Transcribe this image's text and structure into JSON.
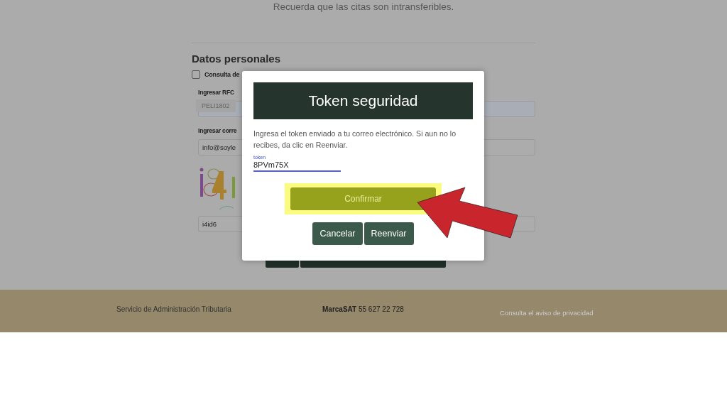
{
  "page": {
    "notice": "Recuerda que las citas son intransferibles.",
    "section_title": "Datos personales",
    "checkbox": {
      "label": "Consulta de",
      "checked": false
    },
    "rfc": {
      "label": "Ingresar RFC",
      "autofill": "PELI1802"
    },
    "email": {
      "label": "Ingresar corre",
      "value": "info@soyle"
    },
    "captcha": {
      "value": "i4id6"
    },
    "buttons": [
      {
        "kind": "exit"
      },
      {
        "kind": "next"
      }
    ]
  },
  "footer": {
    "org": "Servicio de Administración Tributaria",
    "phone": "**MarcaSAT** 55 627 22 728",
    "privacy_link": "Consulta el aviso de privacidad"
  },
  "dialog": {
    "title": "Token seguridad",
    "message": "Ingresa el token enviado a tu correo electrónico. Si aun no lo recibes, da clic en Reenviar.",
    "token": {
      "label": "token",
      "value": "8PVm75X"
    },
    "primary": {
      "label": "Confirmar",
      "highlighted": true
    },
    "actions": [
      {
        "label": "Cancelar"
      },
      {
        "label": "Reenviar"
      }
    ]
  }
}
